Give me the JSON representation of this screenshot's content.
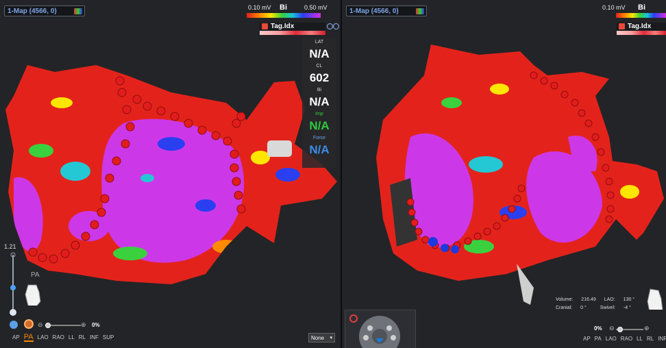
{
  "left": {
    "map_selector": "1-Map (4566, 0)",
    "scale": {
      "min": "0.10 mV",
      "max": "0.50 mV",
      "type": "Bi"
    },
    "tag_index": "Tag.Idx",
    "readout": {
      "lat_label": "LAT",
      "lat_value": "N/A",
      "cl_label": "CL",
      "cl_value": "602",
      "bi_label": "Bi",
      "bi_value": "N/A",
      "imp_label": "Imp",
      "imp_value": "N/A",
      "force_label": "Force",
      "force_value": "N/A"
    },
    "zoom": "1.21",
    "orientation": "PA",
    "percent": "0%",
    "views": [
      "AP",
      "PA",
      "LAO",
      "RAO",
      "LL",
      "RL",
      "INF",
      "SUP"
    ],
    "active_view": "PA",
    "none_select": "None"
  },
  "right": {
    "map_selector": "1-Map (4566, 0)",
    "scale": {
      "min": "0.10 mV",
      "type": "Bi"
    },
    "tag_index": "Tag.Idx",
    "stats": {
      "volume_label": "Volume:",
      "volume_value": "216.49",
      "lao_label": "LAO:",
      "lao_value": "130 °",
      "cranial_label": "Cranial:",
      "cranial_value": "0 °",
      "swivel_label": "Swivel:",
      "swivel_value": "-4 °"
    },
    "percent": "0%",
    "views": [
      "AP",
      "PA",
      "LAO",
      "RAO",
      "LL",
      "RL",
      "INF"
    ]
  },
  "colors": {
    "panel_bg": "#232427",
    "selector_text": "#7fa6e6",
    "active_view": "#ff8a00",
    "imp_green": "#2ecc40",
    "force_blue": "#3b8de8",
    "lesion_red": "#e3231b",
    "map_magenta": "#cc38e8"
  }
}
